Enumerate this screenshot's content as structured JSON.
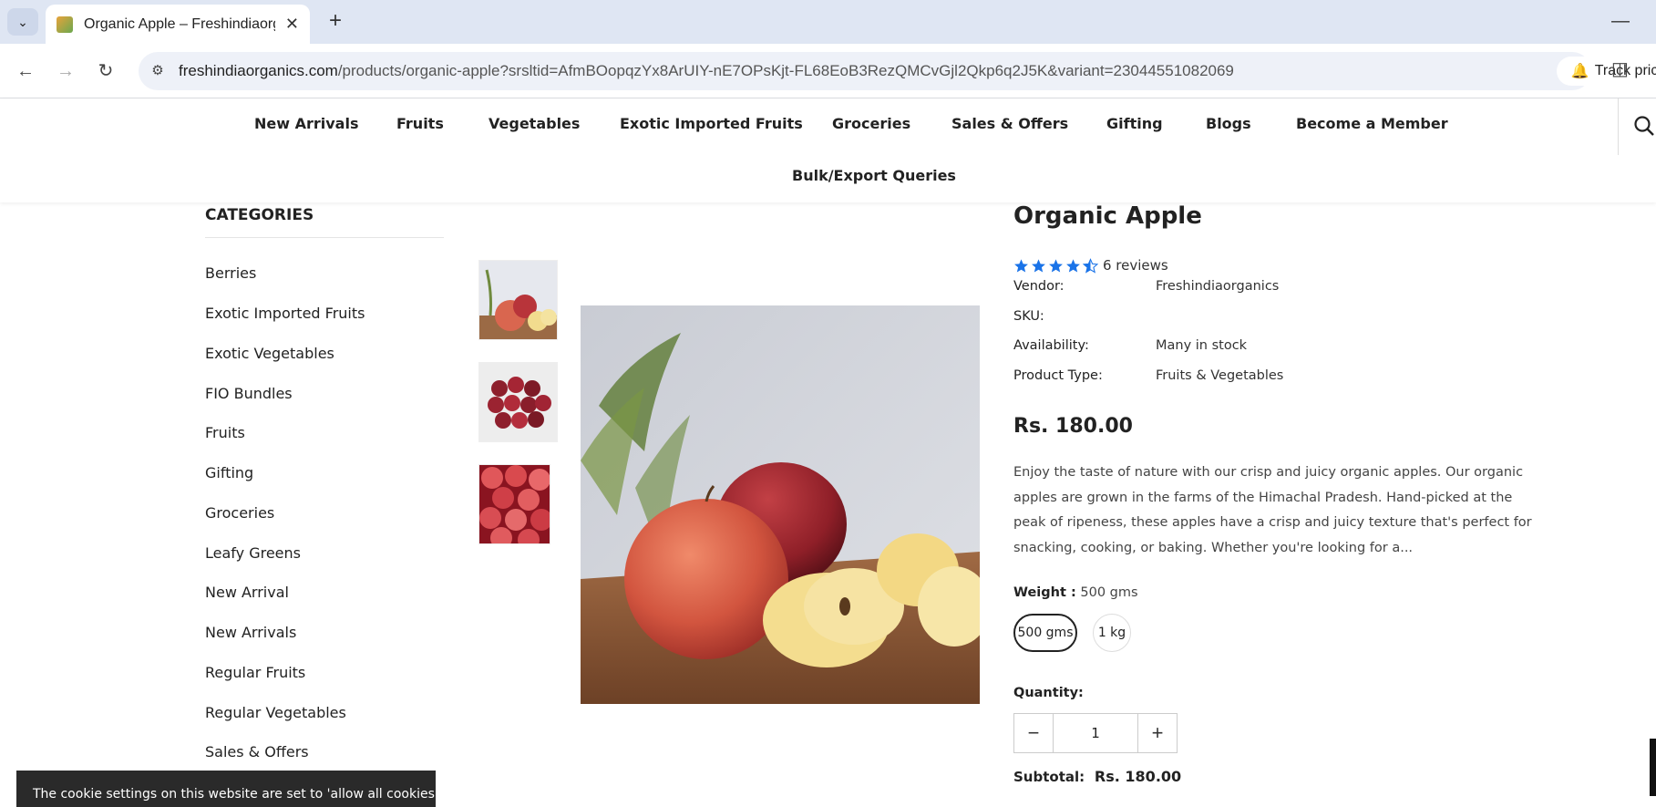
{
  "browser": {
    "tab_title": "Organic Apple – Freshindiaorganics",
    "url_domain": "freshindiaorganics.com",
    "url_path": "/products/organic-apple?srsltid=AfmBOopqzYx8ArUIY-nE7OPsKjt-FL68EoB3RezQMCvGjl2Qkp6q2J5K&variant=23044551082069",
    "track_price_label": "Track price"
  },
  "nav": {
    "items": [
      "New Arrivals",
      "Fruits",
      "Vegetables",
      "Exotic Imported Fruits",
      "Groceries",
      "Sales & Offers",
      "Gifting",
      "Blogs",
      "Become a Member"
    ],
    "bulk": "Bulk/Export Queries"
  },
  "sidebar": {
    "title": "CATEGORIES",
    "items": [
      "Berries",
      "Exotic Imported Fruits",
      "Exotic Vegetables",
      "FIO Bundles",
      "Fruits",
      "Gifting",
      "Groceries",
      "Leafy Greens",
      "New Arrival",
      "New Arrivals",
      "Regular Fruits",
      "Regular Vegetables",
      "Sales & Offers"
    ]
  },
  "product": {
    "title": "Organic Apple",
    "rating": 4.5,
    "reviews": "6 reviews",
    "meta": [
      {
        "label": "Vendor:",
        "value": "Freshindiaorganics"
      },
      {
        "label": "SKU:",
        "value": ""
      },
      {
        "label": "Availability:",
        "value": "Many in stock"
      },
      {
        "label": "Product Type:",
        "value": "Fruits & Vegetables"
      }
    ],
    "price": "Rs. 180.00",
    "description": "Enjoy  the taste of nature with our crisp and juicy organic apples. Our organic apples are grown in the farms of the Himachal Pradesh. Hand-picked at the peak of ripeness, these apples have a crisp and juicy texture that's perfect for snacking, cooking, or baking. Whether you're looking for a...",
    "weight_label": "Weight :",
    "weight_value": "500 gms",
    "weight_options": [
      "500 gms",
      "1 kg"
    ],
    "quantity_label": "Quantity:",
    "quantity": "1",
    "subtotal_label": "Subtotal:",
    "subtotal": "Rs. 180.00"
  },
  "cookie": {
    "text": "The cookie settings on this website are set to 'allow all cookies'"
  },
  "colors": {
    "accent_star": "#1a73e8",
    "chrome_bg": "#dfe6f3"
  }
}
